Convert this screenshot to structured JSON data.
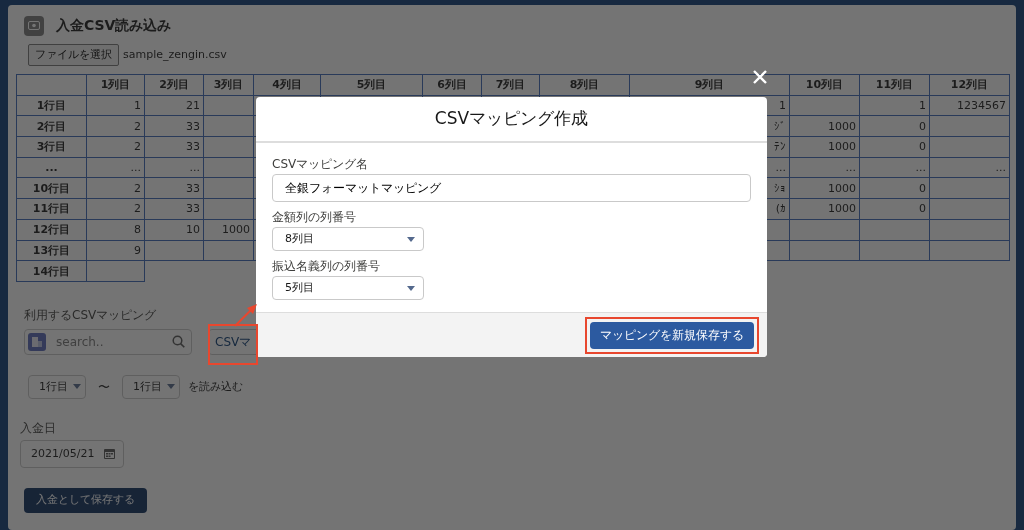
{
  "page": {
    "title": "入金CSV読み込み"
  },
  "file": {
    "button": "ファイルを選択",
    "filename": "sample_zengin.csv"
  },
  "preview_table": {
    "columns": [
      "1列目",
      "2列目",
      "3列目",
      "4列目",
      "5列目",
      "6列目",
      "7列目",
      "8列目",
      "9列目",
      "10列目",
      "11列目",
      "12列目"
    ],
    "rows": [
      {
        "header": "1行目",
        "cells": [
          "1",
          "21",
          null,
          null,
          null,
          null,
          null,
          null,
          "1",
          null,
          "1",
          "1234567"
        ]
      },
      {
        "header": "2行目",
        "cells": [
          "2",
          "33",
          null,
          null,
          null,
          null,
          null,
          null,
          "ｼﾞ",
          "1000",
          "0",
          null
        ]
      },
      {
        "header": "3行目",
        "cells": [
          "2",
          "33",
          null,
          null,
          null,
          null,
          null,
          null,
          "ﾃﾝ",
          "1000",
          "0",
          null
        ]
      },
      {
        "header": "...",
        "cells": [
          "...",
          "...",
          null,
          null,
          null,
          null,
          null,
          null,
          "...",
          "...",
          "...",
          "..."
        ]
      },
      {
        "header": "10行目",
        "cells": [
          "2",
          "33",
          null,
          null,
          null,
          null,
          null,
          null,
          "ｼｮ",
          "1000",
          "0",
          null
        ]
      },
      {
        "header": "11行目",
        "cells": [
          "2",
          "33",
          null,
          null,
          null,
          null,
          null,
          null,
          "(ｶ",
          "1000",
          "0",
          null
        ]
      },
      {
        "header": "12行目",
        "cells": [
          "8",
          "10",
          "1000",
          null,
          null,
          null,
          null,
          null,
          null,
          null,
          null,
          null
        ]
      },
      {
        "header": "13行目",
        "cells": [
          "9",
          null,
          null,
          null,
          null,
          null,
          null,
          null,
          null,
          null,
          null,
          null
        ]
      },
      {
        "header": "14行目",
        "cells": [
          null
        ]
      }
    ]
  },
  "mapping": {
    "label": "利用するCSVマッピング",
    "search_placeholder": "search..",
    "button": "CSVマ"
  },
  "range": {
    "from": "1行目",
    "separator": "〜",
    "to": "1行目",
    "suffix": "を読み込む"
  },
  "deposit_date": {
    "label": "入金日",
    "value": "2021/05/21"
  },
  "save_button": "入金として保存する",
  "modal": {
    "title": "CSVマッピング作成",
    "fields": [
      {
        "kind": "text",
        "label": "CSVマッピング名",
        "value": "全銀フォーマットマッピング"
      },
      {
        "kind": "select",
        "label": "金額列の列番号",
        "value": "8列目"
      },
      {
        "kind": "select",
        "label": "振込名義列の列番号",
        "value": "5列目"
      }
    ],
    "save_button": "マッピングを新規保存する"
  }
}
